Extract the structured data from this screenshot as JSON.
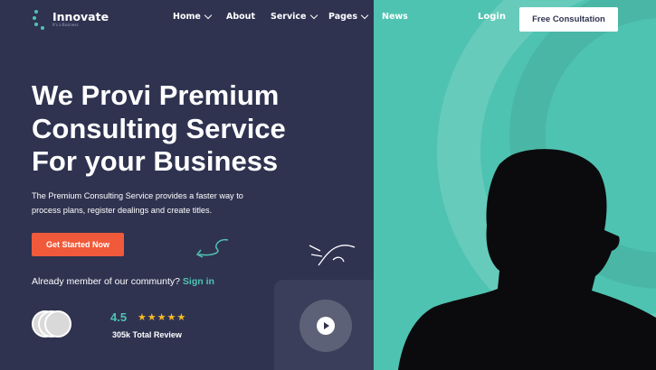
{
  "brand": {
    "name": "Innovate",
    "tagline": "It's a Business"
  },
  "nav": {
    "items": [
      {
        "label": "Home"
      },
      {
        "label": "About"
      },
      {
        "label": "Service"
      },
      {
        "label": "Pages"
      },
      {
        "label": "News"
      }
    ],
    "login_label": "Login",
    "consult_label": "Free Consultation"
  },
  "hero": {
    "headline_1": "We Provi Premium",
    "headline_2": "Consulting Service",
    "headline_3": "For your Business",
    "subtitle_1": "The Premium Consulting Service provides a faster way to",
    "subtitle_2": "process plans, register dealings and create titles.",
    "cta_label": "Get Started Now",
    "member_text": "Already member of our communty?",
    "signin_label": "Sign in",
    "rating": "4.5",
    "stars": "★★★★★",
    "review_text": "305k Total Review"
  },
  "colors": {
    "navy": "#2f3350",
    "teal": "#4fc3b1",
    "accent_orange": "#f05a3a",
    "star": "#f7b924"
  },
  "icons": [
    "logo-dots-icon",
    "chevron-down-icon",
    "arrow-doodle-icon",
    "sparkle-doodle-icon",
    "play-icon",
    "star-icon"
  ]
}
